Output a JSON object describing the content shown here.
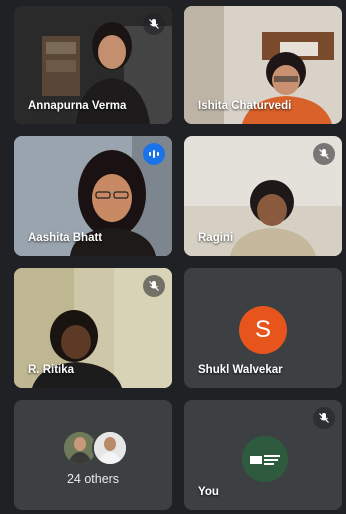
{
  "tiles": [
    {
      "name": "Annapurna Verma",
      "muted": true
    },
    {
      "name": "Ishita Chaturvedi",
      "muted": false
    },
    {
      "name": "Aashita Bhatt",
      "speaking": true
    },
    {
      "name": "Ragini",
      "muted": true
    },
    {
      "name": "R. Ritika",
      "muted": true
    },
    {
      "name": "Shukl Walvekar",
      "avatar_letter": "S",
      "avatar_color": "#e8551c"
    },
    {
      "name": "24 others"
    },
    {
      "name": "You",
      "muted": true
    }
  ],
  "colors": {
    "background": "#202124",
    "tile": "#3c4043",
    "active_border": "#8ab4f8",
    "speaking_badge": "#1a73e8"
  },
  "icons": {
    "muted": "mic-off-icon",
    "speaking": "audio-wave-icon"
  }
}
